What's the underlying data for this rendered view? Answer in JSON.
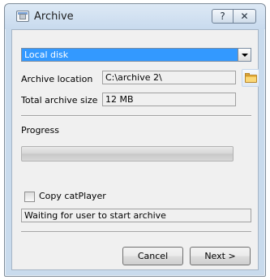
{
  "window": {
    "title": "Archive",
    "help_label": "?",
    "close_label": "✕",
    "app_icon": "archive-window-icon"
  },
  "destination": {
    "selected": "Local disk"
  },
  "archive_location": {
    "label": "Archive location",
    "value": "C:\\archive 2\\",
    "browse_icon": "folder-icon"
  },
  "total_size": {
    "label": "Total archive size",
    "value": "12 MB"
  },
  "progress": {
    "label": "Progress",
    "value_fraction": 0
  },
  "copy_player": {
    "label": "Copy catPlayer",
    "checked": false
  },
  "status": {
    "text": "Waiting for user to start archive"
  },
  "buttons": {
    "cancel": "Cancel",
    "next": "Next >"
  },
  "colors": {
    "selection": "#3399ff",
    "frame": "#c9dbed",
    "client": "#f0f0f0"
  }
}
